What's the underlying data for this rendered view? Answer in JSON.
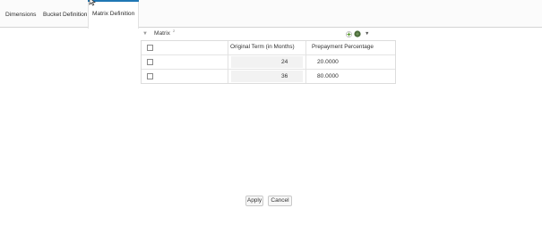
{
  "tabs": [
    {
      "label": "Dimensions"
    },
    {
      "label": "Bucket Definition"
    },
    {
      "label": "Matrix Definition",
      "active": true
    }
  ],
  "matrix": {
    "title": "Matrix",
    "count": "2",
    "columns": [
      "Original Term (in Months)",
      "Prepayment Percentage"
    ],
    "rows": [
      {
        "original_term": "24",
        "prepayment_percentage": "20.0000"
      },
      {
        "original_term": "36",
        "prepayment_percentage": "80.0000"
      }
    ]
  },
  "buttons": {
    "apply": "Apply",
    "cancel": "Cancel"
  },
  "colors": {
    "accent": "#1f77b4",
    "add_icon": "#5aa02c",
    "delete_icon": "#555555"
  },
  "icons": [
    "collapse-arrow-icon",
    "add-icon",
    "delete-icon",
    "menu-caret-icon",
    "mouse-cursor-icon"
  ]
}
